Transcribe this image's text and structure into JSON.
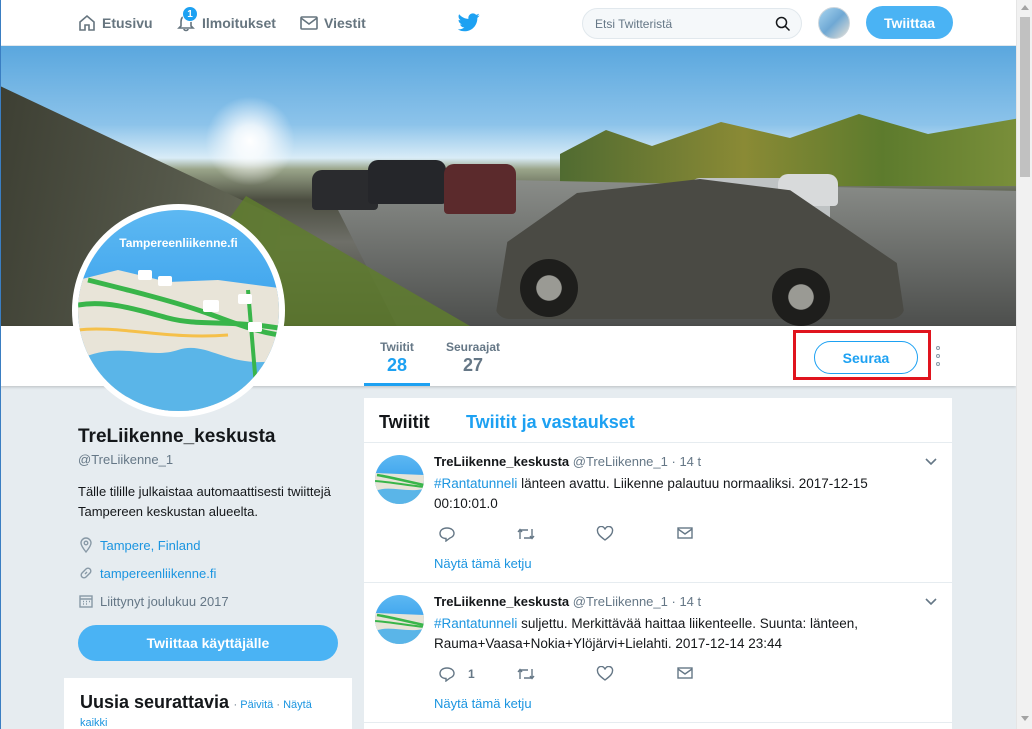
{
  "nav": {
    "home_label": "Etusivu",
    "notifications_label": "Ilmoitukset",
    "notifications_count": "1",
    "messages_label": "Viestit",
    "search_placeholder": "Etsi Twitteristä",
    "tweet_button": "Twiittaa"
  },
  "profile": {
    "avatar_title": "Tampereenliikenne.fi",
    "name": "TreLiikenne_keskusta",
    "handle": "@TreLiikenne_1",
    "bio": "Tälle tilille julkaistaa automaattisesti twiittejä Tampereen keskustan alueelta.",
    "location": "Tampere, Finland",
    "url": "tampereenliikenne.fi",
    "joined": "Liittynyt joulukuu 2017",
    "tweet_to_button": "Twiittaa käyttäjälle"
  },
  "stats": {
    "tweets_label": "Twiitit",
    "tweets_count": "28",
    "followers_label": "Seuraajat",
    "followers_count": "27",
    "follow_button": "Seuraa"
  },
  "who_to_follow": {
    "title": "Uusia seurattavia",
    "separator": "·",
    "refresh": "Päivitä",
    "view_all": "Näytä kaikki"
  },
  "timeline": {
    "tab_tweets": "Twiitit",
    "tab_replies": "Twiitit ja vastaukset",
    "tweets": [
      {
        "name": "TreLiikenne_keskusta",
        "handle": "@TreLiikenne_1",
        "time": "· 14 t",
        "hashtag": "#Rantatunneli",
        "text": " länteen avattu. Liikenne palautuu normaaliksi. 2017-12-15 00:10:01.0",
        "reply_count": "",
        "thread_link": "Näytä tämä ketju"
      },
      {
        "name": "TreLiikenne_keskusta",
        "handle": "@TreLiikenne_1",
        "time": "· 14 t",
        "hashtag": "#Rantatunneli",
        "text": " suljettu. Merkittävää haittaa liikenteelle. Suunta: länteen, Rauma+Vaasa+Nokia+Ylöjärvi+Lielahti. 2017-12-14 23:44",
        "reply_count": "1",
        "thread_link": "Näytä tämä ketju"
      }
    ]
  },
  "colors": {
    "accent": "#1da1f2",
    "highlight_box": "#e0141e",
    "background": "#e6ecf0"
  }
}
